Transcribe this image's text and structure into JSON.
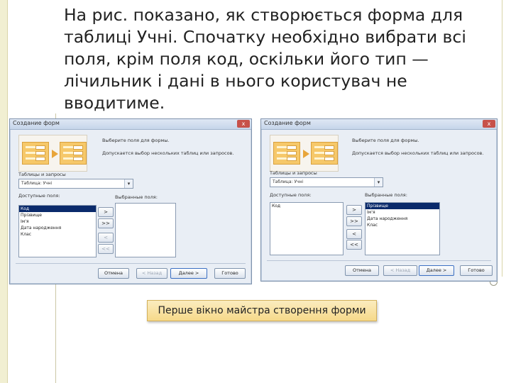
{
  "body_text": "На рис. показано, як створюється форма для таблиці Учні. Спочатку необхідно вибрати всі поля, крім поля код, оскільки його тип — лічильник і дані в нього користувач не вводитиме.",
  "caption": "Перше вікно майстра створення форми",
  "dialogs": [
    {
      "title": "Создание форм",
      "close": "x",
      "prompt1": "Выберите поля для формы.",
      "prompt2": "Допускается выбор нескольких таблиц или запросов.",
      "table_label": "Таблицы и запросы",
      "table_value": "Таблица: Учні",
      "available_label": "Доступные поля:",
      "selected_label": "Выбранные поля:",
      "available_fields": [
        "Код",
        "Прізвище",
        "Ім'я",
        "Дата народження",
        "Клас"
      ],
      "selected_fields": [],
      "available_selected_index": 0,
      "move_buttons": [
        ">",
        ">>",
        "<",
        "<<"
      ],
      "move_enabled": [
        true,
        true,
        false,
        false
      ],
      "buttons": {
        "cancel": "Отмена",
        "back": "< Назад",
        "next": "Далее >",
        "finish": "Готово"
      }
    },
    {
      "title": "Создание форм",
      "close": "x",
      "prompt1": "Выберите поля для формы.",
      "prompt2": "Допускается выбор нескольких таблиц или запросов.",
      "table_label": "Таблицы и запросы",
      "table_value": "Таблица: Учні",
      "available_label": "Доступные поля:",
      "selected_label": "Выбранные поля:",
      "available_fields": [
        "Код"
      ],
      "selected_fields": [
        "Прізвище",
        "Ім'я",
        "Дата народження",
        "Клас"
      ],
      "selected_selected_index": 0,
      "move_buttons": [
        ">",
        ">>",
        "<",
        "<<"
      ],
      "move_enabled": [
        true,
        true,
        true,
        true
      ],
      "buttons": {
        "cancel": "Отмена",
        "back": "< Назад",
        "next": "Далее >",
        "finish": "Готово"
      }
    }
  ],
  "colors": {
    "selection": "#0a2a6b",
    "caption_bg": "#f6d98a",
    "dialog_bg": "#e9eef5"
  }
}
